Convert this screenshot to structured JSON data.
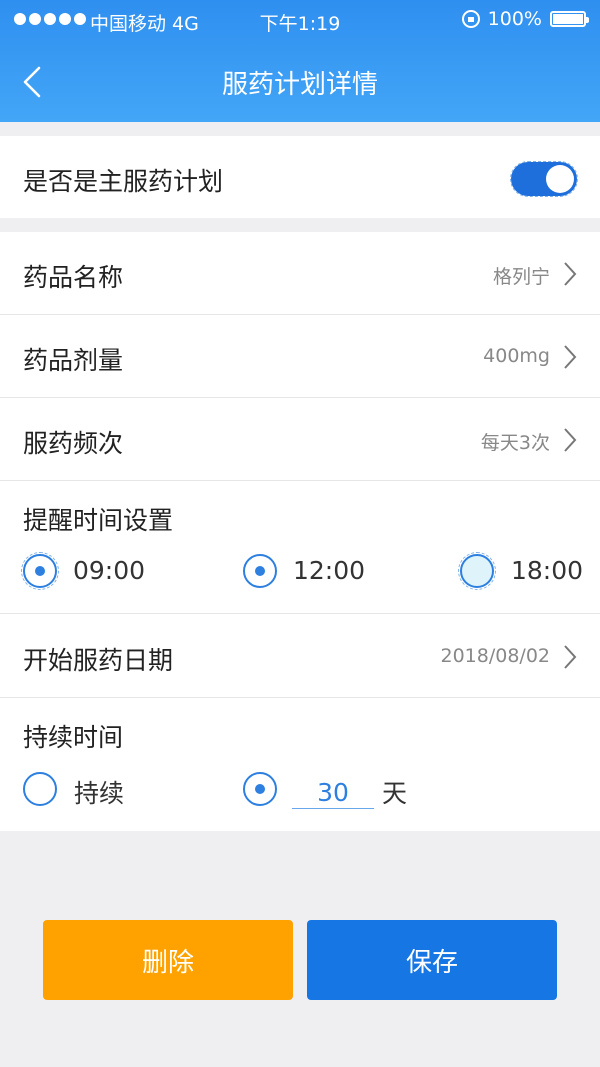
{
  "status_bar": {
    "carrier": "中国移动  4G",
    "time": "下午1:19",
    "battery": "100%"
  },
  "nav": {
    "title": "服药计划详情",
    "back_icon": "chevron-left-icon"
  },
  "main_plan": {
    "label": "是否是主服药计划",
    "enabled": true
  },
  "drug": {
    "name_label": "药品名称",
    "name_value": "格列宁",
    "dose_label": "药品剂量",
    "dose_value": "400mg",
    "freq_label": "服药频次",
    "freq_value": "每天3次"
  },
  "reminder": {
    "label": "提醒时间设置",
    "times": [
      {
        "time": "09:00",
        "checked": true
      },
      {
        "time": "12:00",
        "checked": true
      },
      {
        "time": "18:00",
        "checked": false
      }
    ]
  },
  "start_date": {
    "label": "开始服药日期",
    "value": "2018/08/02"
  },
  "duration": {
    "label": "持续时间",
    "option_continuous": "持续",
    "days_value": "30",
    "days_unit": "天",
    "selected": "days"
  },
  "buttons": {
    "delete": "删除",
    "save": "保存"
  },
  "colors": {
    "header": "#3a9cf4",
    "accent": "#1e6fdc",
    "delete": "#ffa200",
    "save": "#1676e4"
  }
}
